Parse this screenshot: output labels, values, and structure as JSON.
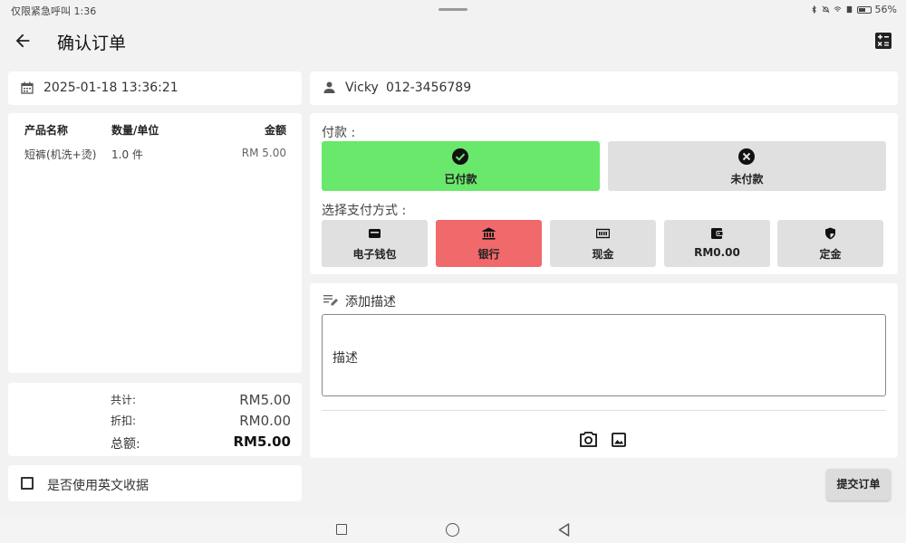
{
  "status_bar": {
    "left_text": "仅限紧急呼叫 1:36",
    "battery": "56%"
  },
  "header": {
    "title": "确认订单",
    "icons": {
      "back": "arrow-left-icon",
      "calculator": "calculator-icon"
    }
  },
  "order": {
    "datetime": "2025-01-18 13:36:21",
    "customer_name": "Vicky",
    "customer_phone": "012-3456789"
  },
  "items_table": {
    "columns": [
      "产品名称",
      "数量/单位",
      "金额"
    ],
    "rows": [
      {
        "name": "短裤(机洗+烫)",
        "qty": "1.0 件",
        "amount": "RM 5.00"
      }
    ]
  },
  "totals": {
    "subtotal_label": "共计:",
    "subtotal": "RM5.00",
    "discount_label": "折扣:",
    "discount": "RM0.00",
    "total_label": "总额:",
    "total": "RM5.00"
  },
  "english_receipt": {
    "label": "是否使用英文收据",
    "checked": false
  },
  "payment": {
    "label": "付款 :",
    "paid_label": "已付款",
    "unpaid_label": "未付款",
    "selected_status": "已付款",
    "method_label": "选择支付方式 :",
    "methods": [
      {
        "label": "电子钱包",
        "icon": "wallet-icon"
      },
      {
        "label": "银行",
        "icon": "bank-icon"
      },
      {
        "label": "现金",
        "icon": "cash-icon"
      },
      {
        "label": "RM0.00",
        "icon": "account-balance-wallet-icon"
      },
      {
        "label": "定金",
        "icon": "shield-icon"
      }
    ],
    "selected_method": "银行"
  },
  "description": {
    "title": "添加描述",
    "placeholder": "描述"
  },
  "submit_label": "提交订单",
  "colors": {
    "paid_active": "#69e86c",
    "method_active": "#f0696b",
    "button_inactive": "#e0e0e0",
    "background": "#f2f2f2"
  }
}
